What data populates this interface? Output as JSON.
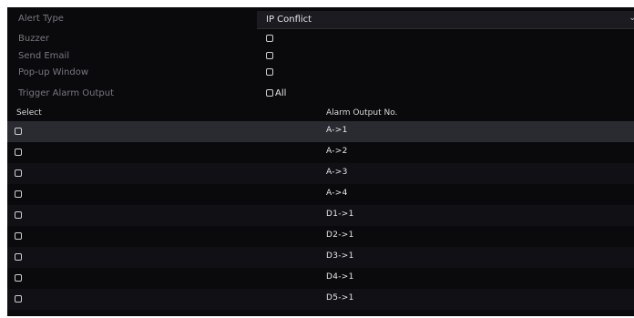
{
  "settings": {
    "alert_type_label": "Alert Type",
    "alert_type_value": "IP Conflict",
    "buzzer_label": "Buzzer",
    "buzzer_checked": false,
    "send_email_label": "Send Email",
    "send_email_checked": false,
    "popup_label": "Pop-up Window",
    "popup_checked": false,
    "trigger_label": "Trigger Alarm Output",
    "trigger_all_label": "All",
    "trigger_all_checked": false
  },
  "table": {
    "col_select": "Select",
    "col_output": "Alarm Output No.",
    "rows": [
      {
        "output": "A->1",
        "checked": false
      },
      {
        "output": "A->2",
        "checked": false
      },
      {
        "output": "A->3",
        "checked": false
      },
      {
        "output": "A->4",
        "checked": false
      },
      {
        "output": "D1->1",
        "checked": false
      },
      {
        "output": "D2->1",
        "checked": false
      },
      {
        "output": "D3->1",
        "checked": false
      },
      {
        "output": "D4->1",
        "checked": false
      },
      {
        "output": "D5->1",
        "checked": false
      }
    ]
  },
  "colors": {
    "background": "#0a0a0d",
    "label_gray": "#77787e",
    "text_white": "#e6e6e8",
    "row_highlight": "#2a2b31"
  }
}
